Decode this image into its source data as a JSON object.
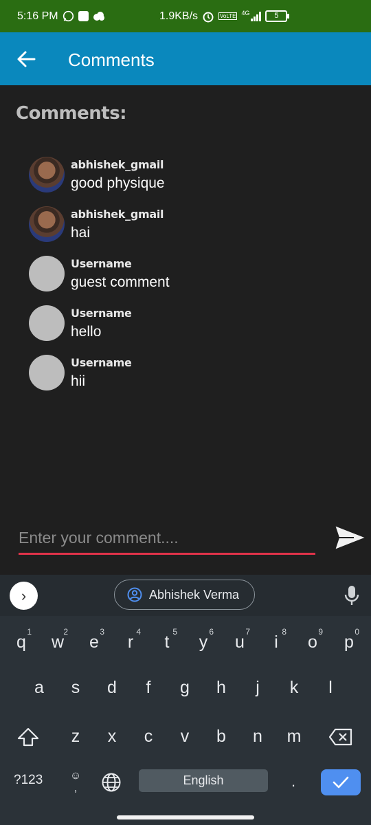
{
  "status_bar": {
    "time": "5:16 PM",
    "net_speed": "1.9KB/s",
    "network_type": "4G",
    "volte_tag": "VoLTE",
    "battery": "5"
  },
  "app_bar": {
    "title": "Comments"
  },
  "section": {
    "heading": "Comments:"
  },
  "comments": [
    {
      "user": "abhishek_gmail",
      "text": "good physique",
      "avatar": "photo"
    },
    {
      "user": "abhishek_gmail",
      "text": "hai",
      "avatar": "photo"
    },
    {
      "user": "Username",
      "text": "guest comment",
      "avatar": "placeholder"
    },
    {
      "user": "Username",
      "text": "hello",
      "avatar": "placeholder"
    },
    {
      "user": "Username",
      "text": "hii",
      "avatar": "placeholder"
    }
  ],
  "composer": {
    "placeholder": "Enter your comment....",
    "value": ""
  },
  "keyboard": {
    "account_name": "Abhishek Verma",
    "row1": [
      "q",
      "w",
      "e",
      "r",
      "t",
      "y",
      "u",
      "i",
      "o",
      "p"
    ],
    "row1_hints": [
      "1",
      "2",
      "3",
      "4",
      "5",
      "6",
      "7",
      "8",
      "9",
      "0"
    ],
    "row2": [
      "a",
      "s",
      "d",
      "f",
      "g",
      "h",
      "j",
      "k",
      "l"
    ],
    "row3": [
      "z",
      "x",
      "c",
      "v",
      "b",
      "n",
      "m"
    ],
    "symbols_label": "?123",
    "comma": ",",
    "space_label": "English",
    "period": "."
  },
  "colors": {
    "status_bar": "#2a6d12",
    "app_bar": "#0a88bd",
    "background": "#1f1f1f",
    "input_underline": "#e0334a",
    "enter_key": "#4f8ff0"
  }
}
